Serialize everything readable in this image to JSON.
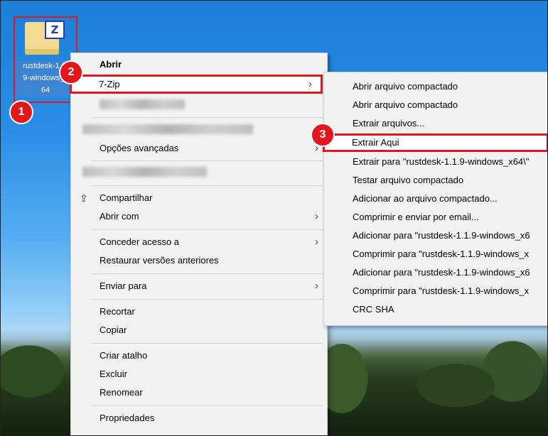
{
  "desktop": {
    "icon_label_line1": "rustdesk-1.1.",
    "icon_label_line2": "9-windows_x",
    "icon_label_line3": "64",
    "badge_z": "Z"
  },
  "badges": {
    "b1": "1",
    "b2": "2",
    "b3": "3"
  },
  "context_menu": {
    "open": "Abrir",
    "seven_zip": "7-Zip",
    "advanced": "Opções avançadas",
    "share": "Compartilhar",
    "open_with": "Abrir com",
    "grant_access": "Conceder acesso a",
    "restore": "Restaurar versões anteriores",
    "send_to": "Enviar para",
    "cut": "Recortar",
    "copy": "Copiar",
    "create_shortcut": "Criar atalho",
    "delete": "Excluir",
    "rename": "Renomear",
    "properties": "Propriedades"
  },
  "submenu": {
    "items": [
      "Abrir arquivo compactado",
      "Abrir arquivo compactado",
      "Extrair arquivos...",
      "Extrair Aqui",
      "Extrair para \"rustdesk-1.1.9-windows_x64\\\"",
      "Testar arquivo compactado",
      "Adicionar ao arquivo compactado...",
      "Comprimir e enviar por email...",
      "Adicionar para \"rustdesk-1.1.9-windows_x6",
      "Comprimir para \"rustdesk-1.1.9-windows_x",
      "Adicionar para \"rustdesk-1.1.9-windows_x6",
      "Comprimir para \"rustdesk-1.1.9-windows_x",
      "CRC SHA"
    ]
  },
  "colors": {
    "highlight": "#e4161b",
    "menu_bg": "#f2f2f2"
  },
  "icons": {
    "share": "share-icon",
    "submenu_arrow": "chevron-right-icon"
  }
}
